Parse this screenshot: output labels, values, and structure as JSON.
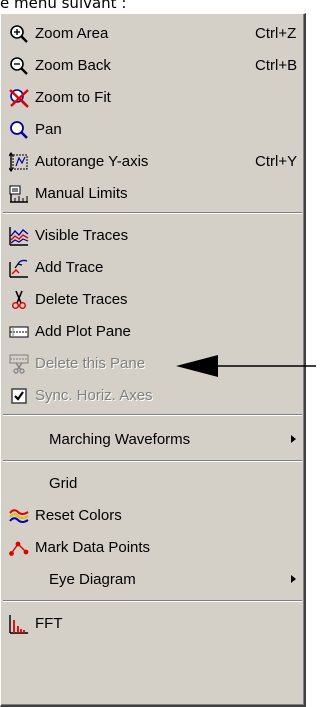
{
  "page": {
    "heading_fragment": "e menu suivant :"
  },
  "menu": {
    "items": [
      {
        "label": "Zoom Area",
        "accel": "Ctrl+Z",
        "icon": "zoom-in-icon",
        "enabled": true
      },
      {
        "label": "Zoom Back",
        "accel": "Ctrl+B",
        "icon": "zoom-out-icon",
        "enabled": true
      },
      {
        "label": "Zoom to Fit",
        "accel": "",
        "icon": "zoom-fit-icon",
        "enabled": true
      },
      {
        "label": "Pan",
        "accel": "",
        "icon": "pan-icon",
        "enabled": true
      },
      {
        "label": "Autorange Y-axis",
        "accel": "Ctrl+Y",
        "icon": "autorange-icon",
        "enabled": true
      },
      {
        "label": "Manual Limits",
        "accel": "",
        "icon": "manual-limits-icon",
        "enabled": true
      },
      {
        "label": "Visible Traces",
        "accel": "",
        "icon": "visible-traces-icon",
        "enabled": true
      },
      {
        "label": "Add Trace",
        "accel": "",
        "icon": "add-trace-icon",
        "enabled": true
      },
      {
        "label": "Delete Traces",
        "accel": "",
        "icon": "scissors-icon",
        "enabled": true
      },
      {
        "label": "Add Plot Pane",
        "accel": "",
        "icon": "plot-pane-icon",
        "enabled": true
      },
      {
        "label": "Delete this Pane",
        "accel": "",
        "icon": "delete-pane-icon",
        "enabled": false
      },
      {
        "label": "Sync. Horiz. Axes",
        "accel": "",
        "icon": "checkbox-icon",
        "enabled": false,
        "checked": true
      },
      {
        "label": "Marching Waveforms",
        "accel": "",
        "icon": "",
        "enabled": true,
        "submenu": true
      },
      {
        "label": "Grid",
        "accel": "",
        "icon": "",
        "enabled": true
      },
      {
        "label": "Reset Colors",
        "accel": "",
        "icon": "reset-colors-icon",
        "enabled": true
      },
      {
        "label": "Mark Data Points",
        "accel": "",
        "icon": "mark-points-icon",
        "enabled": true
      },
      {
        "label": "Eye Diagram",
        "accel": "",
        "icon": "",
        "enabled": true,
        "submenu": true
      },
      {
        "label": "FFT",
        "accel": "",
        "icon": "fft-icon",
        "enabled": true
      }
    ]
  },
  "colors": {
    "menu_bg": "#d4d0c8",
    "disabled_text": "#808080",
    "icon_blue": "#0000a0",
    "icon_red": "#e00000"
  }
}
